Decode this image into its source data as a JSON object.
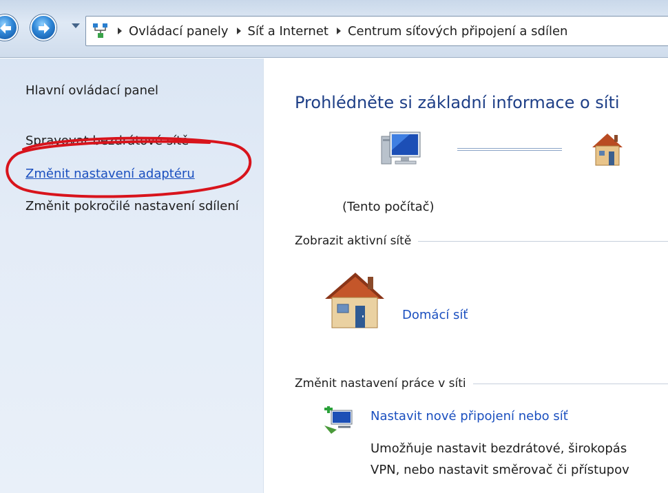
{
  "breadcrumb": {
    "items": [
      "Ovládací panely",
      "Síť a Internet",
      "Centrum síťových připojení a sdílen"
    ]
  },
  "left_pane": {
    "links": [
      "Hlavní ovládací panel",
      "Spravovat bezdrátové sítě",
      "Změnit nastavení adaptéru",
      "Změnit pokročilé nastavení sdílení"
    ]
  },
  "main": {
    "title": "Prohlédněte si základní informace o síti",
    "pc_caption": "(Tento počítač)",
    "active_networks_heading": "Zobrazit aktivní sítě",
    "network_name": "Domácí síť",
    "change_settings_heading": "Změnit nastavení práce v síti",
    "setup_link": "Nastavit nové připojení nebo síť",
    "setup_desc_line1": "Umožňuje nastavit bezdrátové, širokopás",
    "setup_desc_line2": "VPN, nebo nastavit směrovač či přístupov"
  },
  "icons": {
    "back": "back-arrow-icon",
    "forward": "forward-arrow-icon",
    "address": "network-center-icon",
    "computer": "computer-icon",
    "home_small": "home-network-icon",
    "home_large": "home-network-icon",
    "setup": "new-connection-icon"
  },
  "colors": {
    "link": "#1a4fbf",
    "title": "#1e3f87",
    "highlight_ellipse": "#d8141c",
    "left_pane_bg": "#e4ecf7"
  }
}
